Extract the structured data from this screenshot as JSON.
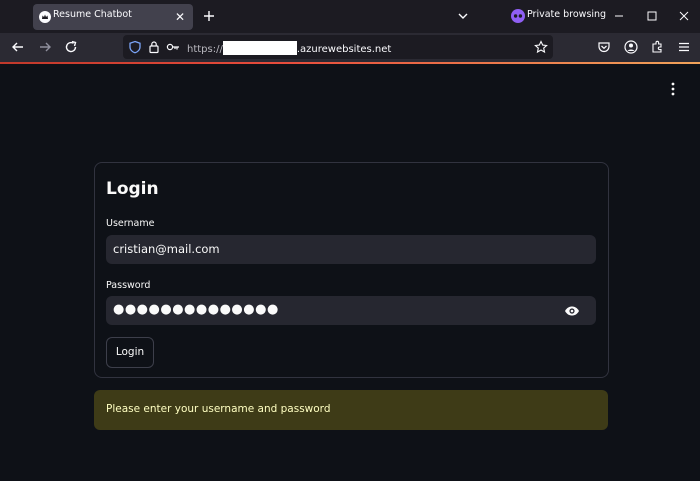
{
  "tab": {
    "title": "Resume Chatbot",
    "close_glyph": "✕"
  },
  "browser": {
    "private_label": "Private browsing"
  },
  "url": {
    "scheme": "https://",
    "domain": ".azurewebsites.net"
  },
  "login": {
    "title": "Login",
    "username_label": "Username",
    "username_value": "cristian@mail.com",
    "password_label": "Password",
    "password_masked": "●●●●●●●●●●●●●●",
    "button_label": "Login"
  },
  "warning": {
    "text": "Please enter your username and password"
  },
  "colors": {
    "page_bg": "#0e1117",
    "input_bg": "#262730",
    "warning_bg": "#3e3b17",
    "warning_text": "#ffffc2",
    "private_accent": "#8f5ff3"
  },
  "icons": [
    "back-icon",
    "forward-icon",
    "reload-icon",
    "shield-icon",
    "lock-icon",
    "key-icon",
    "bookmark-star-icon",
    "pocket-icon",
    "account-icon",
    "extensions-icon",
    "menu-icon",
    "eye-icon",
    "kebab-menu-icon"
  ]
}
